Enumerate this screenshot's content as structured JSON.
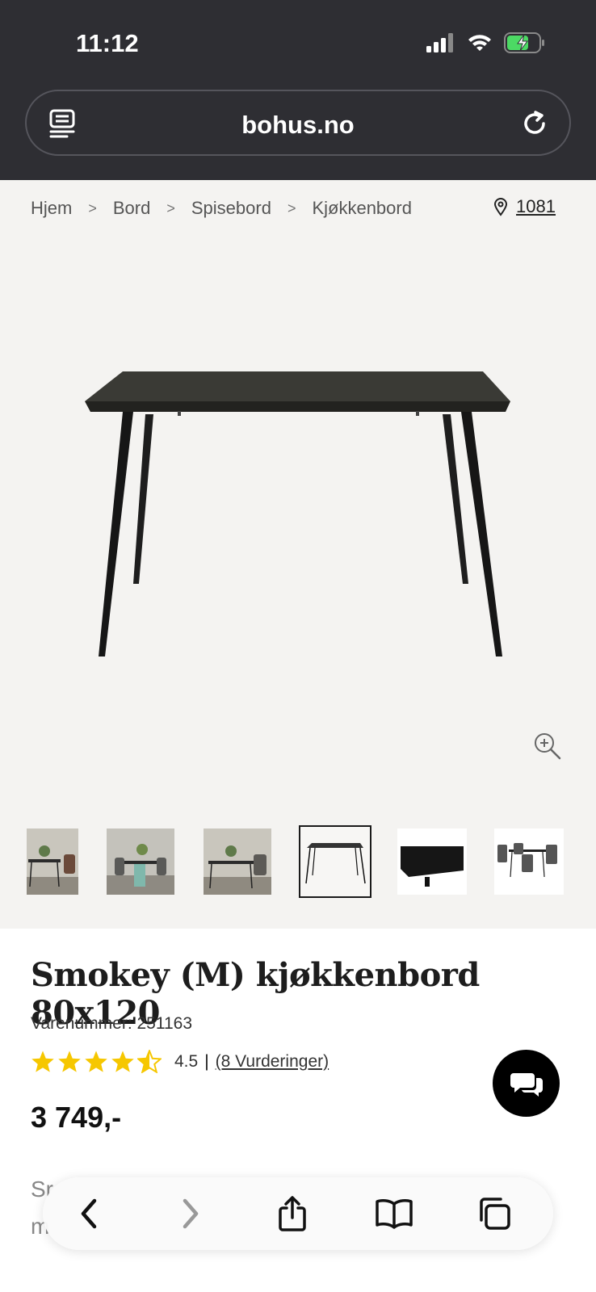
{
  "status_bar": {
    "time": "11:12"
  },
  "browser": {
    "url": "bohus.no"
  },
  "breadcrumb": {
    "items": [
      "Hjem",
      "Bord",
      "Spisebord",
      "Kjøkkenbord"
    ],
    "separator": ">"
  },
  "store": {
    "label": "1081"
  },
  "gallery": {
    "thumbnails": [
      {
        "alt": "room scene 1",
        "selected": false
      },
      {
        "alt": "room scene 2",
        "selected": false
      },
      {
        "alt": "room scene 3",
        "selected": false
      },
      {
        "alt": "table only",
        "selected": true
      },
      {
        "alt": "table top detail",
        "selected": false
      },
      {
        "alt": "table with chairs",
        "selected": false
      }
    ]
  },
  "product": {
    "title": "Smokey (M) kjøkkenbord 80x120",
    "sku": "Varenummer: 251163",
    "rating_value": "4.5",
    "rating_stars": 4.5,
    "rating_sep": "|",
    "reviews_link": "(8 Vurderinger)",
    "price": "3 749,-",
    "description_fragment_1": "Sr",
    "description_fragment_2": "m"
  },
  "colors": {
    "star": "#f6c700",
    "dark": "#2e2e33",
    "accent": "#000000"
  }
}
